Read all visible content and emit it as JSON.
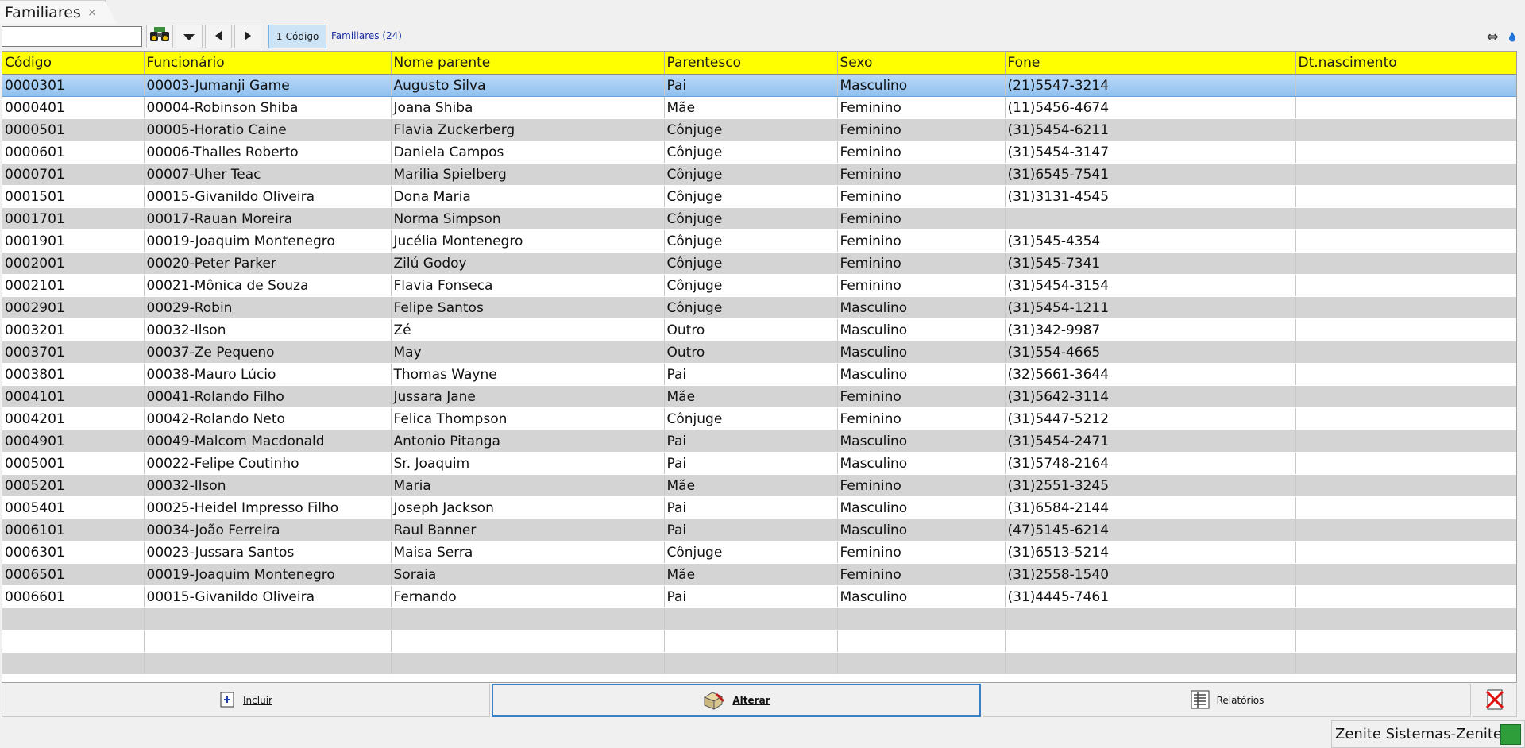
{
  "tab": {
    "title": "Familiares",
    "close": "×"
  },
  "toolbar": {
    "search_value": "",
    "order_button": "1-Código",
    "count_label": "Familiares (24)"
  },
  "columns": [
    "Código",
    "Funcionário",
    "Nome parente",
    "Parentesco",
    "Sexo",
    "Fone",
    "Dt.nascimento"
  ],
  "rows": [
    [
      "0000301",
      "00003-Jumanji Game",
      "Augusto Silva",
      "Pai",
      "Masculino",
      "(21)5547-3214",
      ""
    ],
    [
      "0000401",
      "00004-Robinson Shiba",
      "Joana Shiba",
      "Mãe",
      "Feminino",
      "(11)5456-4674",
      ""
    ],
    [
      "0000501",
      "00005-Horatio Caine",
      "Flavia Zuckerberg",
      "Cônjuge",
      "Feminino",
      "(31)5454-6211",
      ""
    ],
    [
      "0000601",
      "00006-Thalles Roberto",
      "Daniela Campos",
      "Cônjuge",
      "Feminino",
      "(31)5454-3147",
      ""
    ],
    [
      "0000701",
      "00007-Uher Teac",
      "Marilia Spielberg",
      "Cônjuge",
      "Feminino",
      "(31)6545-7541",
      ""
    ],
    [
      "0001501",
      "00015-Givanildo Oliveira",
      "Dona Maria",
      "Cônjuge",
      "Feminino",
      "(31)3131-4545",
      ""
    ],
    [
      "0001701",
      "00017-Rauan Moreira",
      "Norma Simpson",
      "Cônjuge",
      "Feminino",
      "",
      ""
    ],
    [
      "0001901",
      "00019-Joaquim Montenegro",
      "Jucélia Montenegro",
      "Cônjuge",
      "Feminino",
      "(31)545-4354",
      ""
    ],
    [
      "0002001",
      "00020-Peter Parker",
      "Zilú Godoy",
      "Cônjuge",
      "Feminino",
      "(31)545-7341",
      ""
    ],
    [
      "0002101",
      "00021-Mônica de Souza",
      "Flavia Fonseca",
      "Cônjuge",
      "Feminino",
      "(31)5454-3154",
      ""
    ],
    [
      "0002901",
      "00029-Robin",
      "Felipe Santos",
      "Cônjuge",
      "Masculino",
      "(31)5454-1211",
      ""
    ],
    [
      "0003201",
      "00032-Ilson",
      "Zé",
      "Outro",
      "Masculino",
      "(31)342-9987",
      ""
    ],
    [
      "0003701",
      "00037-Ze Pequeno",
      "May",
      "Outro",
      "Masculino",
      "(31)554-4665",
      ""
    ],
    [
      "0003801",
      "00038-Mauro Lúcio",
      "Thomas Wayne",
      "Pai",
      "Masculino",
      "(32)5661-3644",
      ""
    ],
    [
      "0004101",
      "00041-Rolando Filho",
      "Jussara Jane",
      "Mãe",
      "Feminino",
      "(31)5642-3114",
      ""
    ],
    [
      "0004201",
      "00042-Rolando Neto",
      "Felica Thompson",
      "Cônjuge",
      "Feminino",
      "(31)5447-5212",
      ""
    ],
    [
      "0004901",
      "00049-Malcom Macdonald",
      "Antonio Pitanga",
      "Pai",
      "Masculino",
      "(31)5454-2471",
      ""
    ],
    [
      "0005001",
      "00022-Felipe Coutinho",
      "Sr. Joaquim",
      "Pai",
      "Masculino",
      "(31)5748-2164",
      ""
    ],
    [
      "0005201",
      "00032-Ilson",
      "Maria",
      "Mãe",
      "Feminino",
      "(31)2551-3245",
      ""
    ],
    [
      "0005401",
      "00025-Heidel Impresso Filho",
      "Joseph Jackson",
      "Pai",
      "Masculino",
      "(31)6584-2144",
      ""
    ],
    [
      "0006101",
      "00034-João Ferreira",
      "Raul Banner",
      "Pai",
      "Masculino",
      "(47)5145-6214",
      ""
    ],
    [
      "0006301",
      "00023-Jussara Santos",
      "Maisa Serra",
      "Cônjuge",
      "Feminino",
      "(31)6513-5214",
      ""
    ],
    [
      "0006501",
      "00019-Joaquim Montenegro",
      "Soraia",
      "Mãe",
      "Feminino",
      "(31)2558-1540",
      ""
    ],
    [
      "0006601",
      "00015-Givanildo Oliveira",
      "Fernando",
      "Pai",
      "Masculino",
      "(31)4445-7461",
      ""
    ]
  ],
  "selected_row_index": 0,
  "empty_rows": 3,
  "buttons": {
    "incluir": "Incluir",
    "alterar": "Alterar",
    "relatorios": "Relatórios"
  },
  "status": {
    "text": "Zenite Sistemas-Zenite"
  },
  "colors": {
    "header": "#ffff00",
    "row_alt": "#d4d4d4",
    "selected": "#9fcaf2",
    "focus_border": "#3c7fc9"
  }
}
